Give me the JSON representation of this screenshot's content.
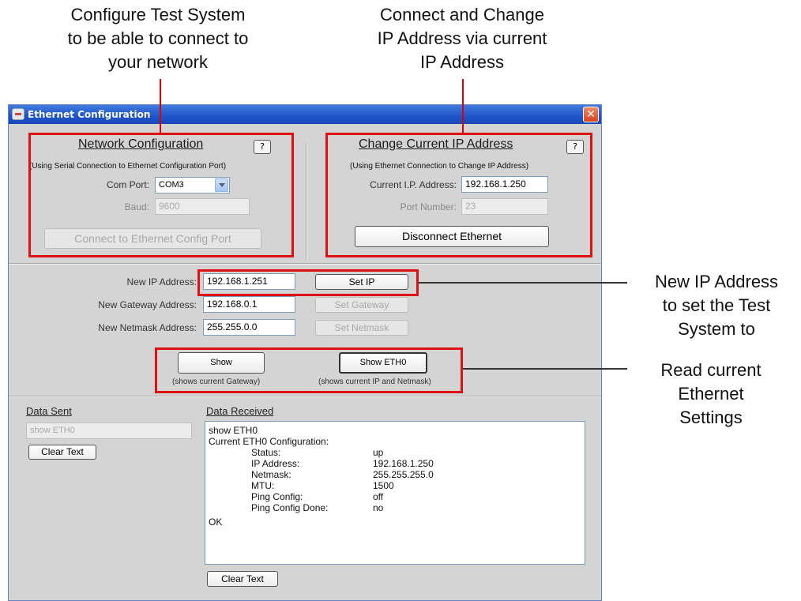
{
  "annotations": {
    "configure": "Configure Test System\nto be able to connect to\nyour network",
    "connect_change": "Connect and Change\nIP Address via current\nIP Address",
    "new_ip": "New IP Address\nto set the Test\nSystem to",
    "read_current": "Read current\nEthernet\nSettings"
  },
  "window": {
    "title": "Ethernet Configuration",
    "close_glyph": "✕"
  },
  "network_config": {
    "title": "Network Configuration",
    "help": "?",
    "subtitle": "(Using Serial Connection to Ethernet Configuration Port)",
    "com_port_label": "Com Port:",
    "com_port_value": "COM3",
    "baud_label": "Baud:",
    "baud_value": "9600",
    "connect_button": "Connect to Ethernet Config Port"
  },
  "change_ip": {
    "title": "Change Current IP Address",
    "help": "?",
    "subtitle": "(Using Ethernet Connection to Change IP Address)",
    "current_ip_label": "Current I.P. Address:",
    "current_ip_value": "192.168.1.250",
    "port_label": "Port Number:",
    "port_value": "23",
    "disconnect_button": "Disconnect Ethernet"
  },
  "set_section": {
    "new_ip_label": "New IP Address:",
    "new_ip_value": "192.168.1.251",
    "set_ip_button": "Set IP",
    "gateway_label": "New Gateway Address:",
    "gateway_value": "192.168.0.1",
    "set_gateway_button": "Set Gateway",
    "netmask_label": "New Netmask Address:",
    "netmask_value": "255.255.0.0",
    "set_netmask_button": "Set Netmask"
  },
  "show_section": {
    "show_button": "Show",
    "show_hint": "(shows current Gateway)",
    "show_eth0_button": "Show ETH0",
    "show_eth0_hint": "(shows current IP and Netmask)"
  },
  "data_sent": {
    "label": "Data Sent",
    "value": "show ETH0",
    "clear_button": "Clear Text"
  },
  "data_received": {
    "label": "Data Received",
    "header_lines": [
      "show ETH0",
      "Current ETH0 Configuration:"
    ],
    "rows": [
      {
        "key": "Status:",
        "value": "up"
      },
      {
        "key": "IP Address:",
        "value": "192.168.1.250"
      },
      {
        "key": "Netmask:",
        "value": "255.255.255.0"
      },
      {
        "key": "MTU:",
        "value": "1500"
      },
      {
        "key": "Ping Config:",
        "value": "off"
      },
      {
        "key": "Ping Config Done:",
        "value": "no"
      }
    ],
    "footer_line": "OK",
    "clear_button": "Clear Text"
  },
  "colors": {
    "highlight_box": "#dd1111",
    "window_bg": "#d4d4d4",
    "titlebar": "#1f54c8"
  }
}
